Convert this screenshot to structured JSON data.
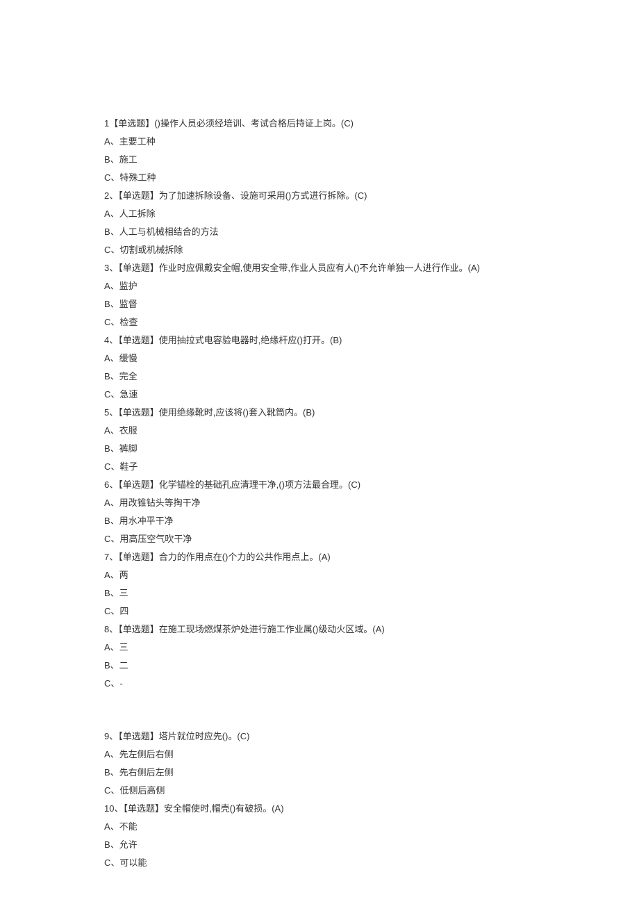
{
  "questions": [
    {
      "stem": "1【单选题】()操作人员必须经培训、考试合格后持证上岗。(C)",
      "options": [
        "A、主要工种",
        "B、施工",
        "C、特殊工种"
      ]
    },
    {
      "stem": "2、【单选题】为了加速拆除设备、设施可采用()方式进行拆除。(C)",
      "options": [
        "A、人工拆除",
        "B、人工与机械相结合的方法",
        "C、切割或机械拆除"
      ]
    },
    {
      "stem": "3、【单选题】作业时应佩戴安全帽,使用安全带,作业人员应有人()不允许单独一人进行作业。(A)",
      "options": [
        "A、监护",
        "B、监督",
        "C、检查"
      ]
    },
    {
      "stem": "4、【单选题】使用抽拉式电容验电器时,绝缘杆应()打开。(B)",
      "options": [
        "A、缓慢",
        "B、完全",
        "C、急速"
      ]
    },
    {
      "stem": "5、【单选题】使用绝缘靴时,应该将()套入靴筒内。(B)",
      "options": [
        "A、衣服",
        "B、裤脚",
        "C、鞋子"
      ]
    },
    {
      "stem": "6、【单选题】化学锚栓的基础孔应清理干净,()项方法最合理。(C)",
      "options": [
        "A、用改锥钻头等掏干净",
        "B、用水冲平干净",
        "C、用高压空气吹干净"
      ]
    },
    {
      "stem": "7、【单选题】合力的作用点在()个力的公共作用点上。(A)",
      "options": [
        "A、两",
        "B、三",
        "C、四"
      ]
    },
    {
      "stem": "8、【单选题】在施工现场燃煤茶炉处进行施工作业属()级动火区域。(A)",
      "options": [
        "A、三",
        "B、二",
        "C、-"
      ]
    },
    {
      "stem": "9、【单选题】塔片就位时应先()。(C)",
      "options": [
        "A、先左侧后右侧",
        "B、先右侧后左侧",
        "C、低侧后高侧"
      ]
    },
    {
      "stem": "10、【单选题】安全帽使时,帽壳()有破损。(A)",
      "options": [
        "A、不能",
        "B、允许",
        "C、可以能"
      ]
    }
  ]
}
